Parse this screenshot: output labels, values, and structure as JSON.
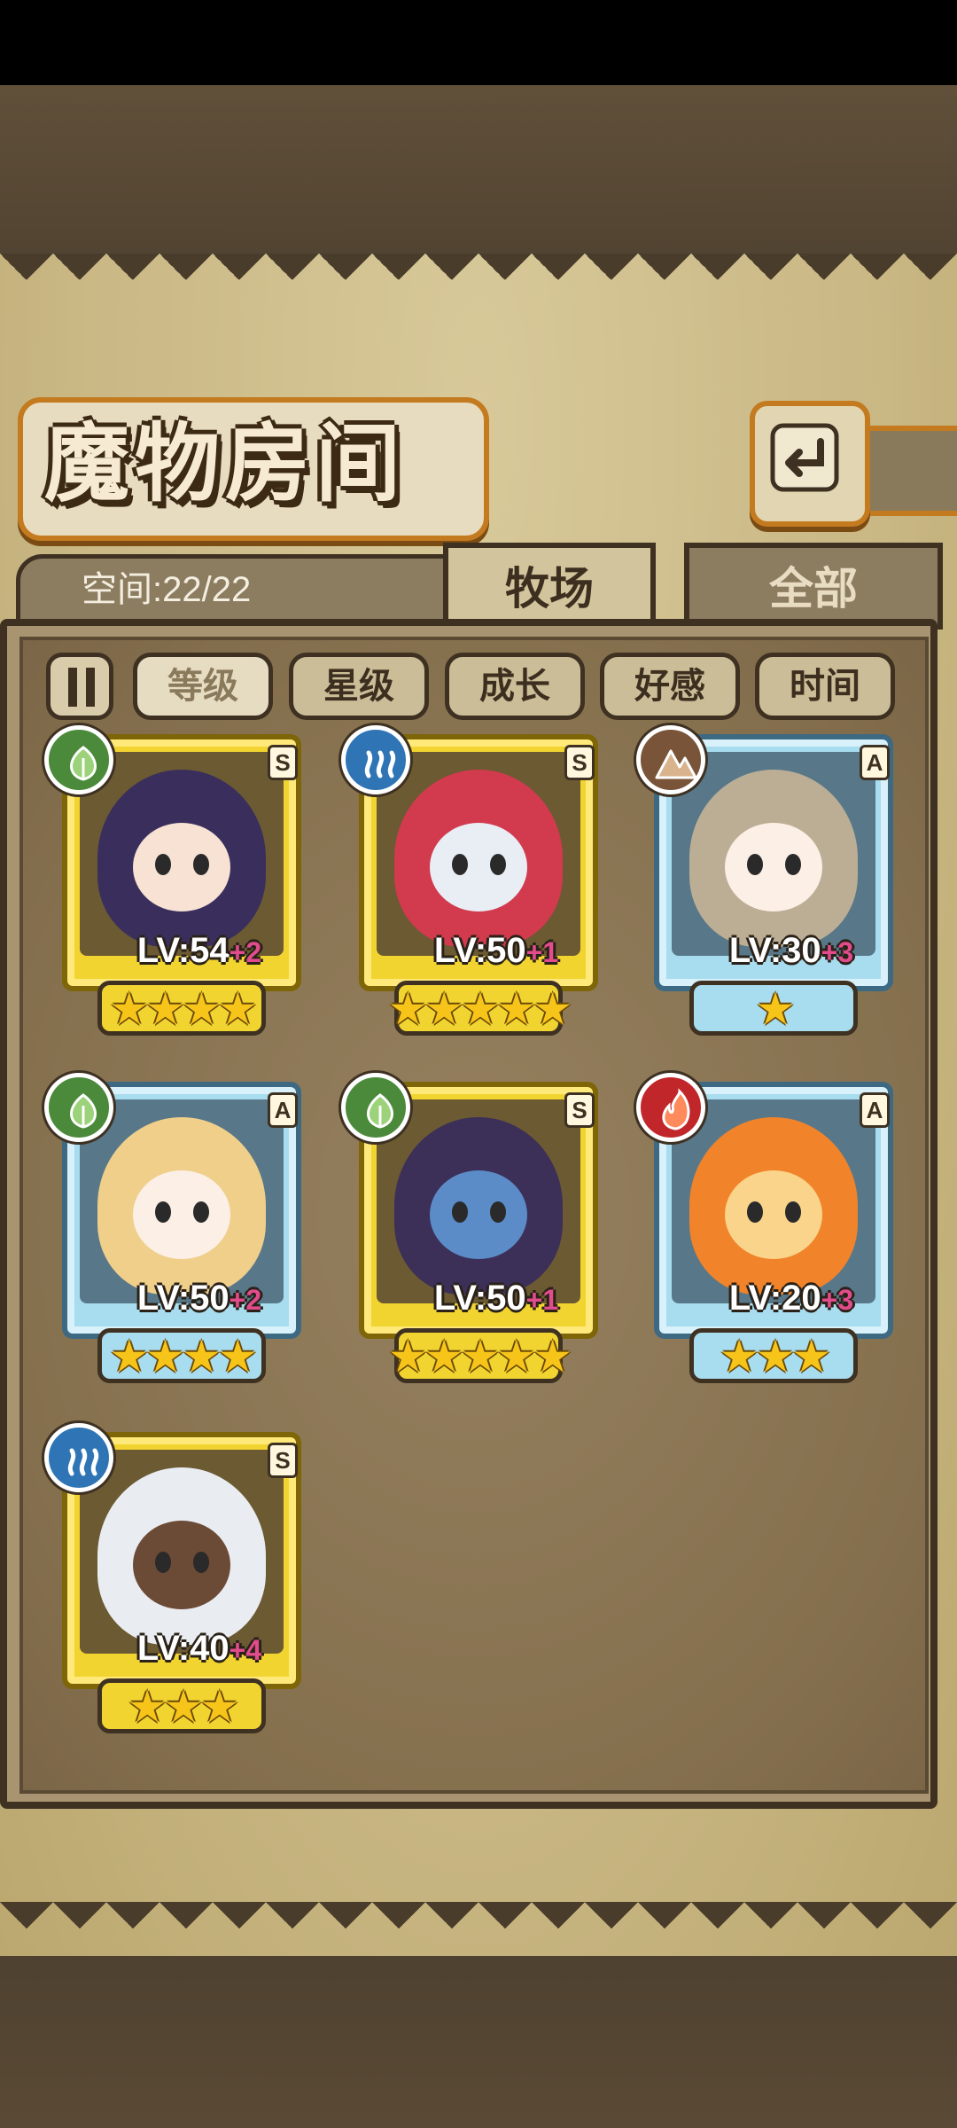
{
  "title": "魔物房间",
  "space_label": "空间:22/22",
  "tabs": [
    {
      "label": "牧场",
      "active": true
    },
    {
      "label": "全部",
      "active": false
    }
  ],
  "sort_buttons": [
    {
      "label": "等级",
      "selected": true
    },
    {
      "label": "星级",
      "selected": false
    },
    {
      "label": "成长",
      "selected": false
    },
    {
      "label": "好感",
      "selected": false
    },
    {
      "label": "时间",
      "selected": false
    }
  ],
  "monsters": [
    {
      "element": "wood",
      "element_icon": "leaf-icon",
      "rank": "S",
      "level": "LV:54",
      "plus": "+2",
      "stars": 4,
      "colors": {
        "hair": "#3a2f5c",
        "face": "#f7e2d3"
      }
    },
    {
      "element": "water",
      "element_icon": "water-waves-icon",
      "rank": "S",
      "level": "LV:50",
      "plus": "+1",
      "stars": 5,
      "colors": {
        "hair": "#d23a4e",
        "face": "#e9eef5"
      }
    },
    {
      "element": "earth",
      "element_icon": "mountain-icon",
      "rank": "A",
      "level": "LV:30",
      "plus": "+3",
      "stars": 1,
      "colors": {
        "hair": "#bcae94",
        "face": "#fbefe6"
      }
    },
    {
      "element": "wood",
      "element_icon": "leaf-icon",
      "rank": "A",
      "level": "LV:50",
      "plus": "+2",
      "stars": 4,
      "colors": {
        "hair": "#f0cf8a",
        "face": "#fbefe6"
      }
    },
    {
      "element": "wood",
      "element_icon": "leaf-icon",
      "rank": "S",
      "level": "LV:50",
      "plus": "+1",
      "stars": 5,
      "colors": {
        "hair": "#3c2f58",
        "face": "#5b8cc8"
      }
    },
    {
      "element": "fire",
      "element_icon": "flame-icon",
      "rank": "A",
      "level": "LV:20",
      "plus": "+3",
      "stars": 3,
      "colors": {
        "hair": "#f1832a",
        "face": "#f9d48a"
      }
    },
    {
      "element": "water",
      "element_icon": "water-waves-icon",
      "rank": "S",
      "level": "LV:40",
      "plus": "+4",
      "stars": 3,
      "colors": {
        "hair": "#e9edf2",
        "face": "#6b4a36"
      }
    }
  ]
}
